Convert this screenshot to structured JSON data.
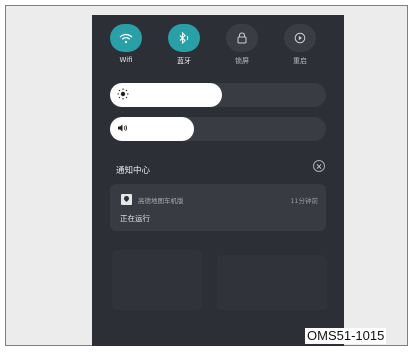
{
  "quick_settings": [
    {
      "label": "Wifi",
      "icon": "wifi-icon",
      "state": "on"
    },
    {
      "label": "蓝牙",
      "icon": "bluetooth-icon",
      "state": "on"
    },
    {
      "label": "锁屏",
      "icon": "lock-icon",
      "state": "off"
    },
    {
      "label": "重启",
      "icon": "restart-icon",
      "state": "off"
    }
  ],
  "sliders": {
    "brightness": {
      "icon": "brightness-icon",
      "level": 0.52
    },
    "volume": {
      "icon": "volume-icon",
      "level": 0.39
    }
  },
  "notifications": {
    "title": "通知中心",
    "items": [
      {
        "app_name": "高德地图车机版",
        "time": "11分钟前",
        "status": "正在运行"
      }
    ]
  },
  "figure_code": "OMS51-1015",
  "colors": {
    "accent": "#27a0a8",
    "background": "#2d2f36",
    "card": "#393b42"
  }
}
